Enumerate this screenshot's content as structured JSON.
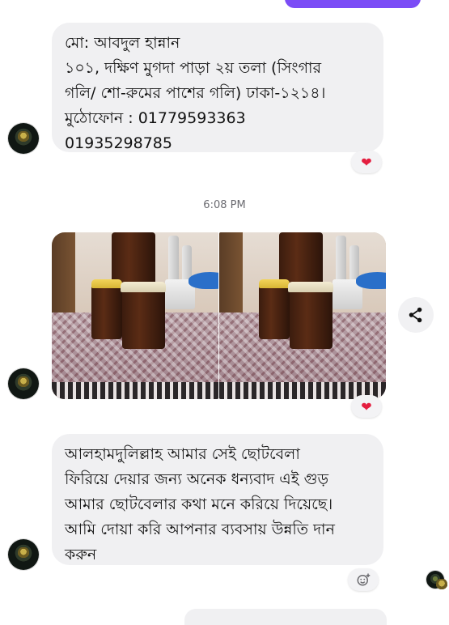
{
  "messages": {
    "first": {
      "lines": [
        "মো: আবদুল হান্নান",
        "১০১, দক্ষিণ মুগদা পাড়া ২য় তলা (সিংগার",
        "গলি/ শো-রুমের পাশের গলি) ঢাকা-১২১৪।",
        "মুঠোফোন : 01779593363",
        "01935298785"
      ],
      "reaction": "❤"
    },
    "timestamp": "6:08 PM",
    "photos": {
      "reaction": "❤",
      "share_icon": "share-icon"
    },
    "third": {
      "lines": [
        "আলহামদুলিল্লাহ আমার সেই ছোটবেলা",
        "ফিরিয়ে দেয়ার জন্য অনেক ধন্যবাদ এই গুড়",
        "আমার ছোটবেলার কথা মনে করিয়ে দিয়েছে।",
        "আমি দোয়া করি আপনার ব্যবসায় উন্নতি দান",
        "করুন"
      ],
      "add_reaction_icon": "add-reaction-icon"
    }
  },
  "colors": {
    "bubble_bg": "#f0f0f2",
    "sent_bubble": "#7b4cf6",
    "heart": "#e41e3f"
  }
}
